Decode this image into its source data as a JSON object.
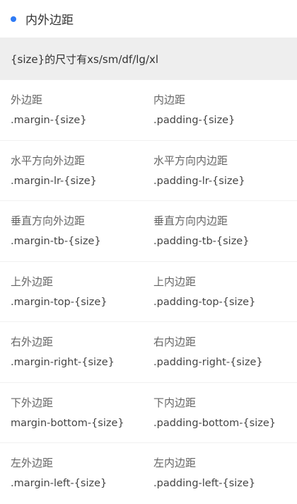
{
  "header": {
    "title": "内外边距"
  },
  "note": "{size}的尺寸有xs/sm/df/lg/xl",
  "accent_color": "#2f7bf5",
  "rows": [
    {
      "left": {
        "title": "外边距",
        "cls": ".margin-{size}"
      },
      "right": {
        "title": "内边距",
        "cls": ".padding-{size}"
      }
    },
    {
      "left": {
        "title": "水平方向外边距",
        "cls": ".margin-lr-{size}"
      },
      "right": {
        "title": "水平方向内边距",
        "cls": ".padding-lr-{size}"
      }
    },
    {
      "left": {
        "title": "垂直方向外边距",
        "cls": ".margin-tb-{size}"
      },
      "right": {
        "title": "垂直方向内边距",
        "cls": ".padding-tb-{size}"
      }
    },
    {
      "left": {
        "title": "上外边距",
        "cls": ".margin-top-{size}"
      },
      "right": {
        "title": "上内边距",
        "cls": ".padding-top-{size}"
      }
    },
    {
      "left": {
        "title": "右外边距",
        "cls": ".margin-right-{size}"
      },
      "right": {
        "title": "右内边距",
        "cls": ".padding-right-{size}"
      }
    },
    {
      "left": {
        "title": "下外边距",
        "cls": "margin-bottom-{size}"
      },
      "right": {
        "title": "下内边距",
        "cls": ".padding-bottom-{size}"
      }
    },
    {
      "left": {
        "title": "左外边距",
        "cls": ".margin-left-{size}"
      },
      "right": {
        "title": "左内边距",
        "cls": ".padding-left-{size}"
      }
    }
  ]
}
